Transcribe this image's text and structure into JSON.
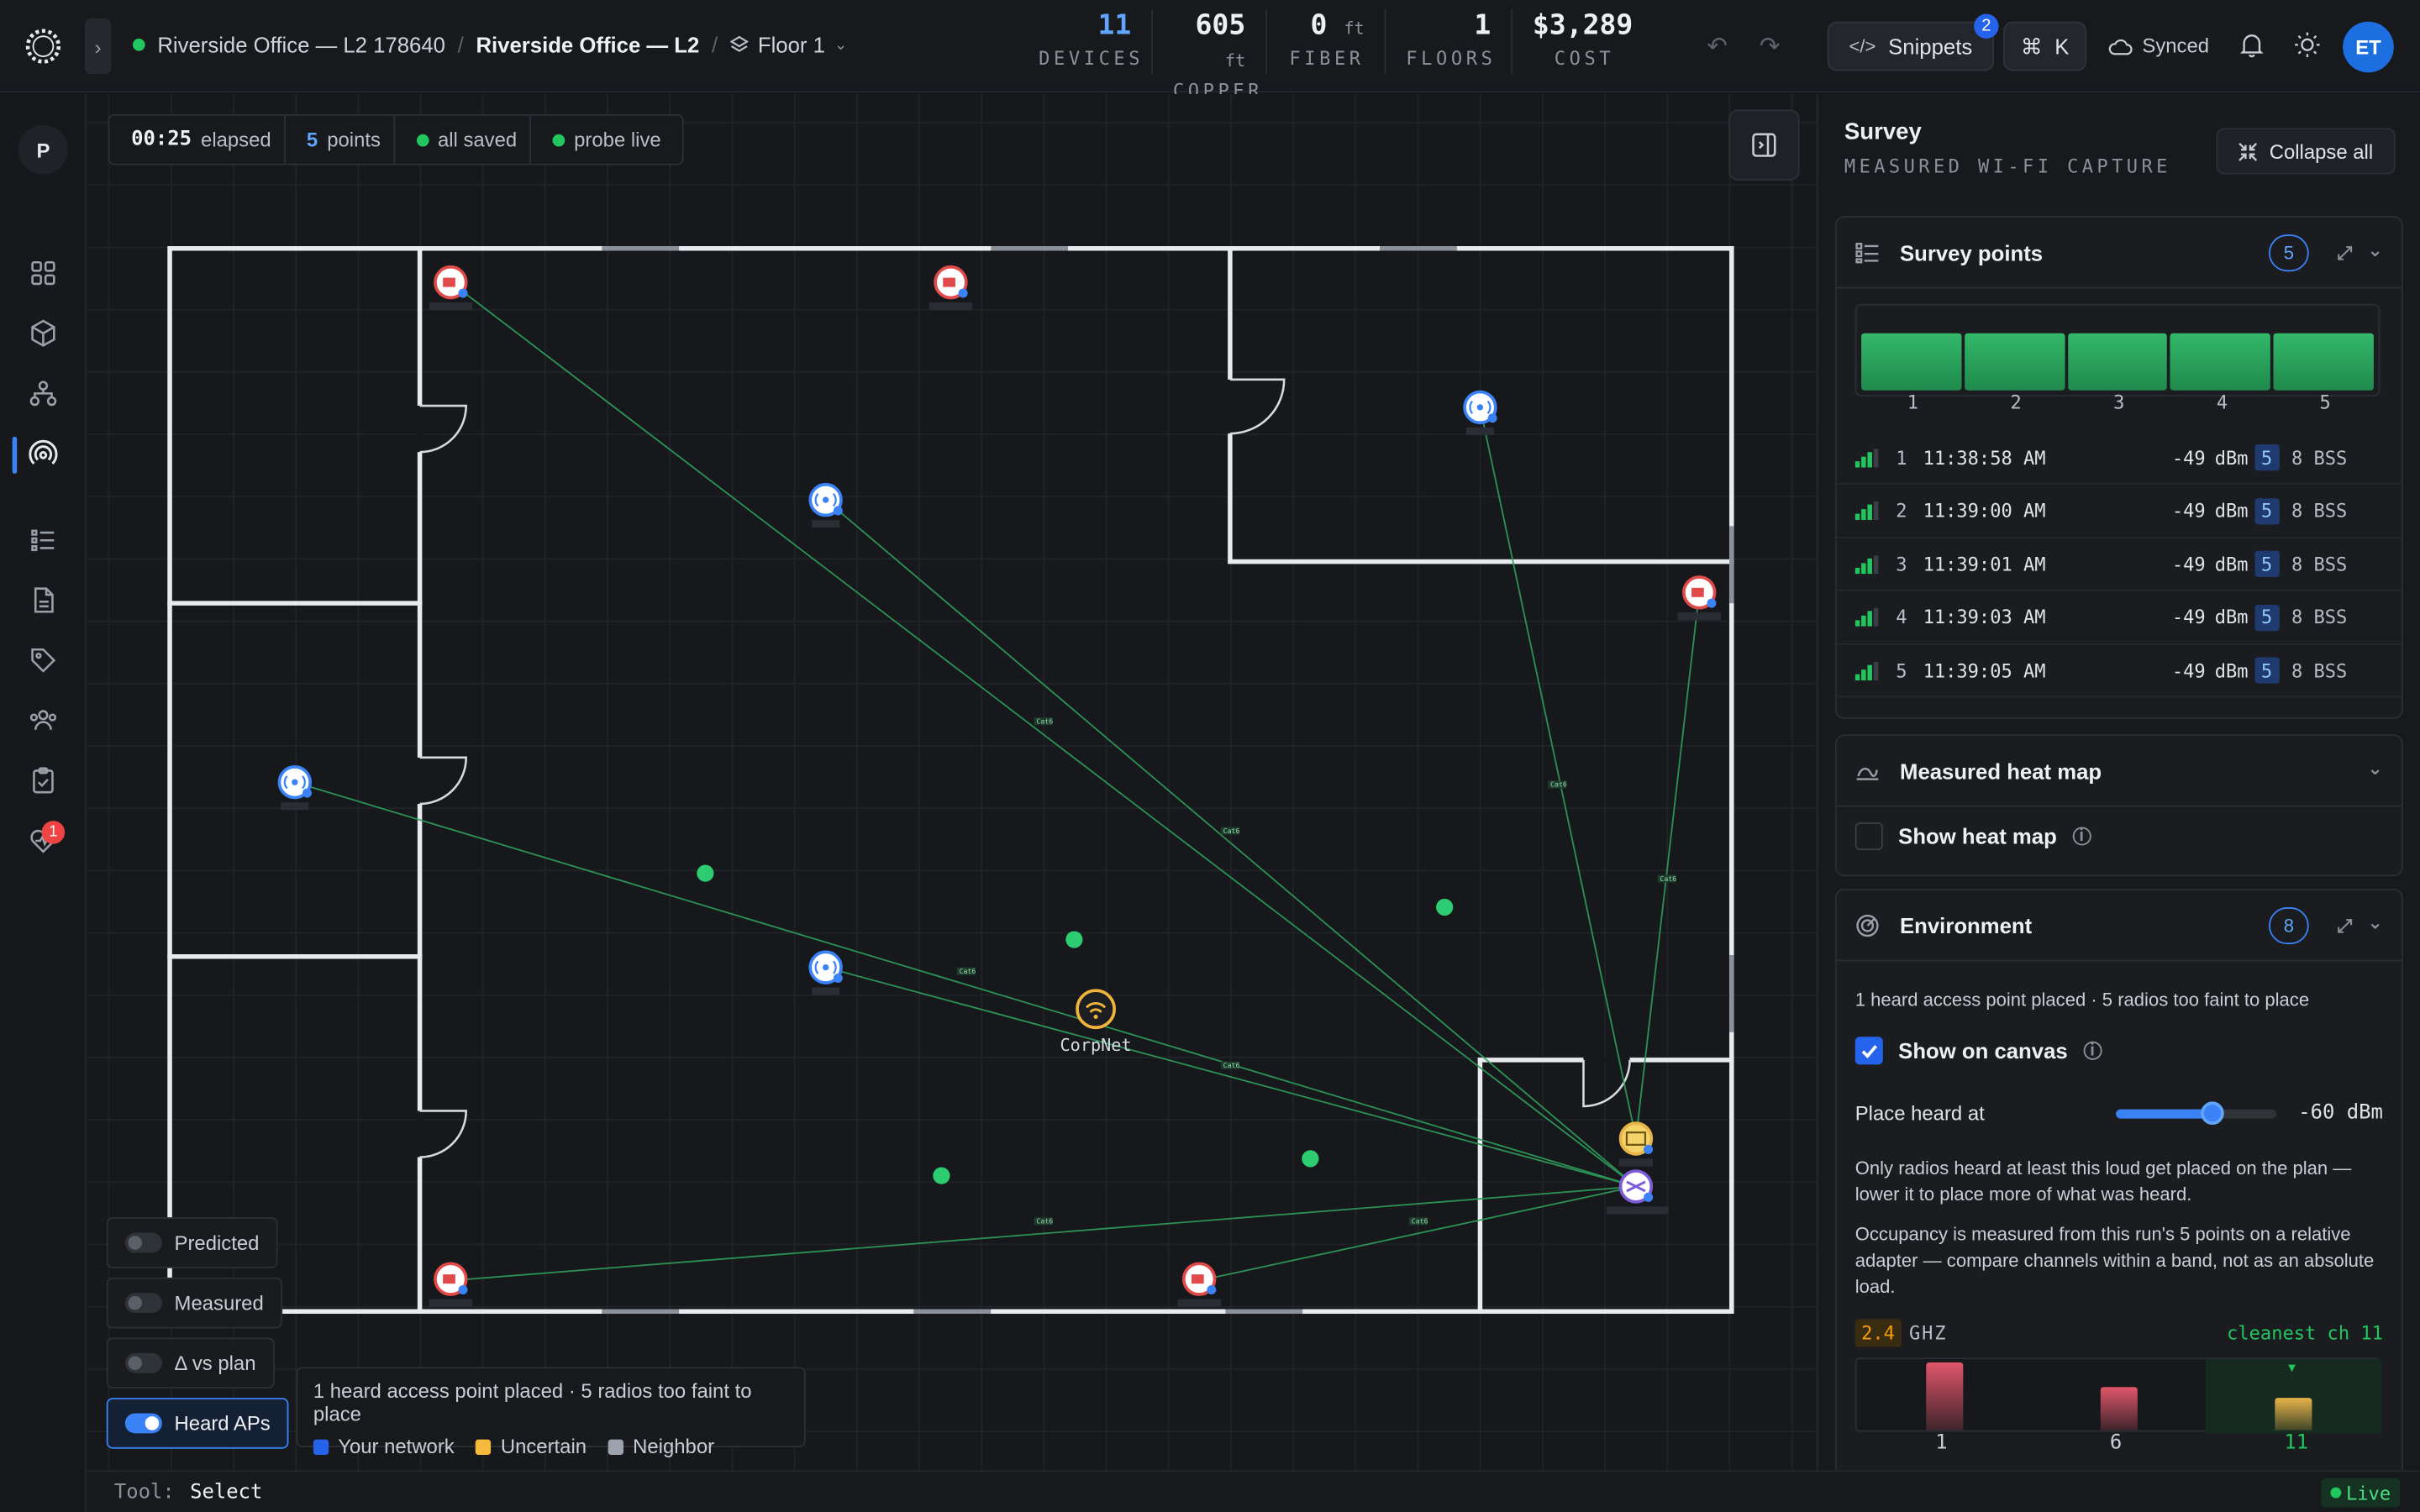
{
  "header": {
    "project": "Riverside Office — L2 178640",
    "site": "Riverside Office — L2",
    "floor": "Floor 1",
    "stats": [
      {
        "value": "11",
        "unit": "",
        "label": "DEVICES"
      },
      {
        "value": "605",
        "unit": "ft",
        "label": "COPPER"
      },
      {
        "value": "0",
        "unit": "ft",
        "label": "FIBER"
      },
      {
        "value": "1",
        "unit": "",
        "label": "FLOORS"
      },
      {
        "value": "$3,289",
        "unit": "",
        "label": "COST"
      }
    ],
    "snippets_label": "Snippets",
    "snippets_badge": "2",
    "cmdk_label": "K",
    "synced_label": "Synced",
    "avatar": "ET"
  },
  "rail": {
    "project_initial": "P",
    "alert_badge": "1"
  },
  "canvas": {
    "elapsed": "00:25",
    "elapsed_label": "elapsed",
    "points": "5",
    "points_label": "points",
    "saved_label": "all saved",
    "probe_label": "probe live",
    "ssid_label": "CorpNet",
    "layers": [
      {
        "label": "Predicted",
        "on": false
      },
      {
        "label": "Measured",
        "on": false
      },
      {
        "label": "Δ vs plan",
        "on": false
      },
      {
        "label": "Heard APs",
        "on": true
      }
    ],
    "legend_title": "1 heard access point placed · 5 radios too faint to place",
    "legend": [
      {
        "label": "Your network",
        "color": "#2563eb"
      },
      {
        "label": "Uncertain",
        "color": "#f5b93b"
      },
      {
        "label": "Neighbor",
        "color": "#9ca3af"
      }
    ],
    "link_label": "Cat6"
  },
  "statusbar": {
    "tool_label": "Tool:",
    "tool_value": "Select",
    "live_label": "Live"
  },
  "survey": {
    "title": "Survey",
    "subtitle": "MEASURED WI-FI CAPTURE",
    "collapse_label": "Collapse all",
    "points_card": {
      "title": "Survey points",
      "count": "5",
      "bar_labels": [
        "1",
        "2",
        "3",
        "4",
        "5"
      ],
      "rows": [
        {
          "n": "1",
          "time": "11:38:58 AM",
          "dbm": "-49",
          "unit": "dBm",
          "ch": "5",
          "bss": "8 BSS"
        },
        {
          "n": "2",
          "time": "11:39:00 AM",
          "dbm": "-49",
          "unit": "dBm",
          "ch": "5",
          "bss": "8 BSS"
        },
        {
          "n": "3",
          "time": "11:39:01 AM",
          "dbm": "-49",
          "unit": "dBm",
          "ch": "5",
          "bss": "8 BSS"
        },
        {
          "n": "4",
          "time": "11:39:03 AM",
          "dbm": "-49",
          "unit": "dBm",
          "ch": "5",
          "bss": "8 BSS"
        },
        {
          "n": "5",
          "time": "11:39:05 AM",
          "dbm": "-49",
          "unit": "dBm",
          "ch": "5",
          "bss": "8 BSS"
        }
      ]
    },
    "heatmap_card": {
      "title": "Measured heat map",
      "show_label": "Show heat map",
      "show": false
    },
    "env_card": {
      "title": "Environment",
      "count": "8",
      "summary": "1 heard access point placed · 5 radios too faint to place",
      "show_canvas_label": "Show on canvas",
      "show_canvas": true,
      "place_label": "Place heard at",
      "place_value": "-60 dBm",
      "place_fraction": 0.6,
      "note1": "Only radios heard at least this loud get placed on the plan — lower it to place more of what was heard.",
      "note2": "Occupancy is measured from this run's 5 points on a relative adapter — compare channels within a band, not as an absolute load.",
      "band": "2.4",
      "band_unit": "GHZ",
      "cleanest": "cleanest ch 11",
      "channels": [
        {
          "ch": "1",
          "level": 0.95,
          "color": "#e0566a"
        },
        {
          "ch": "6",
          "level": 0.6,
          "color": "#e0566a"
        },
        {
          "ch": "11",
          "level": 0.45,
          "color": "#e8b44a"
        }
      ]
    }
  }
}
